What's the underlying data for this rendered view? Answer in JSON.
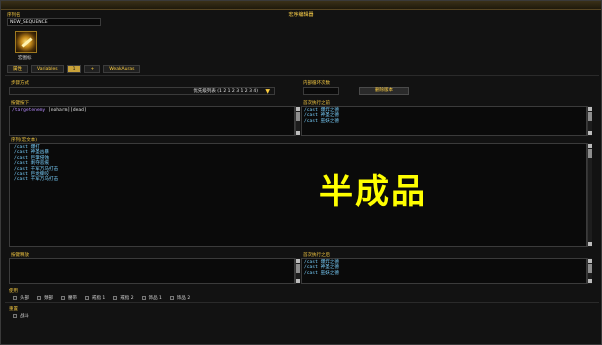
{
  "window": {
    "title": "宏序编辑器"
  },
  "sequence": {
    "label": "序列名",
    "value": "NEW_SEQUENCE"
  },
  "icon": {
    "name": "macro-icon",
    "caption": "宏图标"
  },
  "tabs": [
    {
      "label": "属性"
    },
    {
      "label": "Variables"
    },
    {
      "label": "1"
    },
    {
      "label": "+"
    },
    {
      "label": "WeakAuras"
    }
  ],
  "step": {
    "label": "步骤方式",
    "value": "优先级列表 (1 2 1 2 3 1 2 3 4)"
  },
  "inner": {
    "label": "内部循环次数",
    "button": "删除版本"
  },
  "keypress": {
    "label": "按键按下",
    "line1_cmd": "/targetenemy",
    "line1_cond": "[noharm][dead]"
  },
  "keypress_right": {
    "label": "首次执行之前",
    "lines": [
      "/cast 爆炸之德",
      "/cast 神圣之德",
      "/cast 巫妖之德"
    ]
  },
  "sequence_body": {
    "label": "序列(宏文本)",
    "lines": [
      "/cast 爆打",
      "/cast 神圣凶暴",
      "/cast 巨掌侵蚀",
      "/cast 剥夺恶痕",
      "/cast 千军万马打击",
      "/cast 巨龙撕咬",
      "/cast 千军万马打击"
    ]
  },
  "watermark": "半成品",
  "keyrelease": {
    "label": "按键释放"
  },
  "keyrelease_right": {
    "label": "首次执行之后",
    "lines": [
      "/cast 爆炸之德",
      "/cast 神圣之德",
      "/cast 巫妖之德"
    ]
  },
  "use": {
    "label": "使用",
    "items": [
      "头部",
      "颈部",
      "腰带",
      "戒指 1",
      "戒指 2",
      "饰品 1",
      "饰品 2"
    ]
  },
  "other": {
    "label": "重置",
    "items": [
      "战斗"
    ]
  }
}
